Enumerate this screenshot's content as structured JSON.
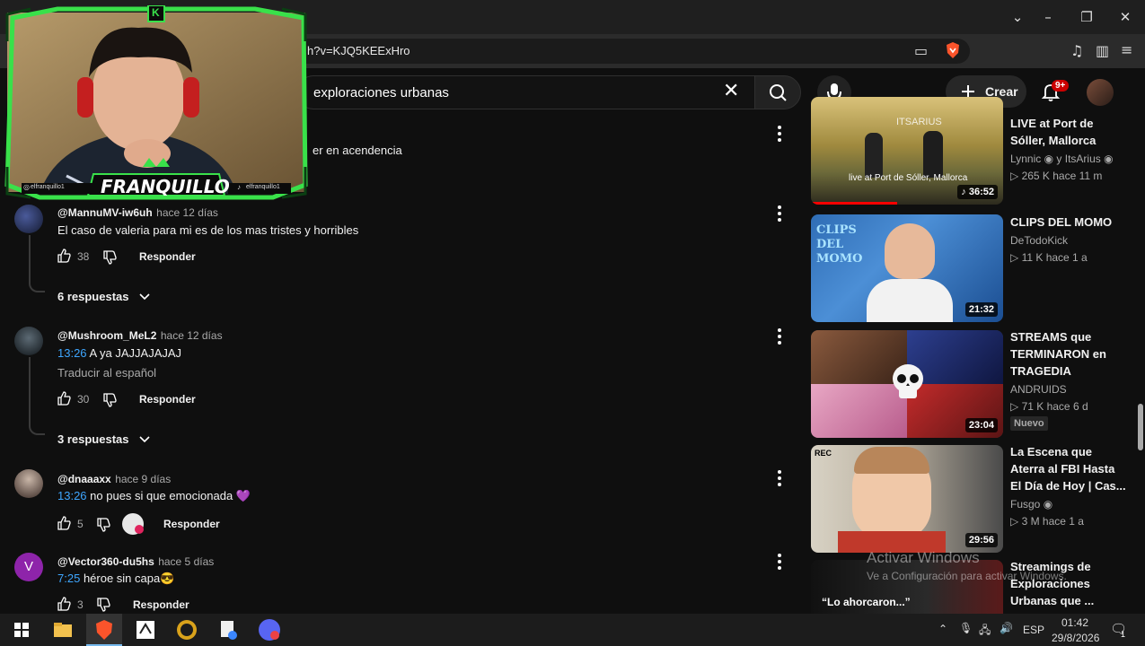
{
  "browser": {
    "url_fragment": "h?v=KJQ5KEExHro",
    "window_controls": [
      "chevron",
      "minimize",
      "restore",
      "close"
    ]
  },
  "youtube_header": {
    "search_value": "exploraciones urbanas",
    "create_label": "Crear",
    "notifications_badge": "9+"
  },
  "partial_comment": {
    "text_tail": "er en acendencia"
  },
  "comments": [
    {
      "handle": "@MannuMV-iw6uh",
      "time": "hace 12 días",
      "timestamp": "",
      "text": "El caso de valeria para mi es de los mas tristes y horribles",
      "translate": "",
      "likes": "38",
      "reply_label": "Responder",
      "replies": "6 respuestas"
    },
    {
      "handle": "@Mushroom_MeL2",
      "time": "hace 12 días",
      "timestamp": "13:26",
      "text": "A ya JAJJAJAJAJ",
      "translate": "Traducir al español",
      "likes": "30",
      "reply_label": "Responder",
      "replies": "3 respuestas"
    },
    {
      "handle": "@dnaaaxx",
      "time": "hace 9 días",
      "timestamp": "13:26",
      "text": "no pues si que emocionada 💜",
      "translate": "",
      "likes": "5",
      "reply_label": "Responder",
      "replies": ""
    },
    {
      "handle": "@Vector360-du5hs",
      "time": "hace 5 días",
      "timestamp": "7:25",
      "text": "héroe sin capa😎",
      "translate": "",
      "likes": "3",
      "reply_label": "Responder",
      "replies": "",
      "avatar_letter": "V"
    }
  ],
  "sidebar": [
    {
      "title_l1": "LIVE at Port de",
      "title_l2": "Sóller, Mallorca",
      "title_l3": "",
      "channel": "Lynnic",
      "channel_extra": "y ItsArius",
      "meta": "▷ 265 K  hace 11 m",
      "duration": "♪ 36:52",
      "thumb_caption": "live at Port de Sóller, Mallorca",
      "thumb_top_text": "ITSARIUS",
      "badge": ""
    },
    {
      "title_l1": "CLIPS DEL MOMO",
      "title_l2": "",
      "title_l3": "",
      "channel": "DeTodoKick",
      "channel_extra": "",
      "meta": "▷ 11 K  hace 1 a",
      "duration": "21:32",
      "thumb_caption": "CLIPS DEL MOMO",
      "thumb_top_text": "",
      "badge": ""
    },
    {
      "title_l1": "STREAMS que",
      "title_l2": "TERMINARON en",
      "title_l3": "TRAGEDIA",
      "channel": "ANDRUIDS",
      "channel_extra": "",
      "meta": "▷ 71 K  hace 6 d",
      "duration": "23:04",
      "thumb_caption": "",
      "thumb_top_text": "",
      "badge": "Nuevo"
    },
    {
      "title_l1": "La Escena que",
      "title_l2": "Aterra al FBI Hasta",
      "title_l3": "El Día de Hoy | Cas...",
      "channel": "Fusgo",
      "channel_extra": "",
      "meta": "▷ 3 M  hace 1 a",
      "duration": "29:56",
      "thumb_caption": "",
      "thumb_top_text": "REC",
      "badge": ""
    },
    {
      "title_l1": "Streamings de",
      "title_l2": "Exploraciones",
      "title_l3": "Urbanas que ...",
      "channel": "",
      "channel_extra": "",
      "meta": "",
      "duration": "",
      "thumb_caption": "“Lo ahorcaron...”",
      "thumb_top_text": "",
      "badge": ""
    }
  ],
  "webcam": {
    "name": "FRANQUILLO",
    "logo_letter": "K",
    "handle_left": "elfranquillo1",
    "handle_right": "elfranquillo1"
  },
  "watermark": {
    "line1": "Activar Windows",
    "line2": "Ve a Configuración para activar Windows."
  },
  "taskbar": {
    "language": "ESP",
    "time": "01:42",
    "date": "29/8/2026",
    "notification_count": "1"
  },
  "colors": {
    "background": "#0f0f0f",
    "timestamp_link": "#3ea6ff",
    "notification_red": "#cc0000",
    "webcam_frame": "#39e14a"
  }
}
